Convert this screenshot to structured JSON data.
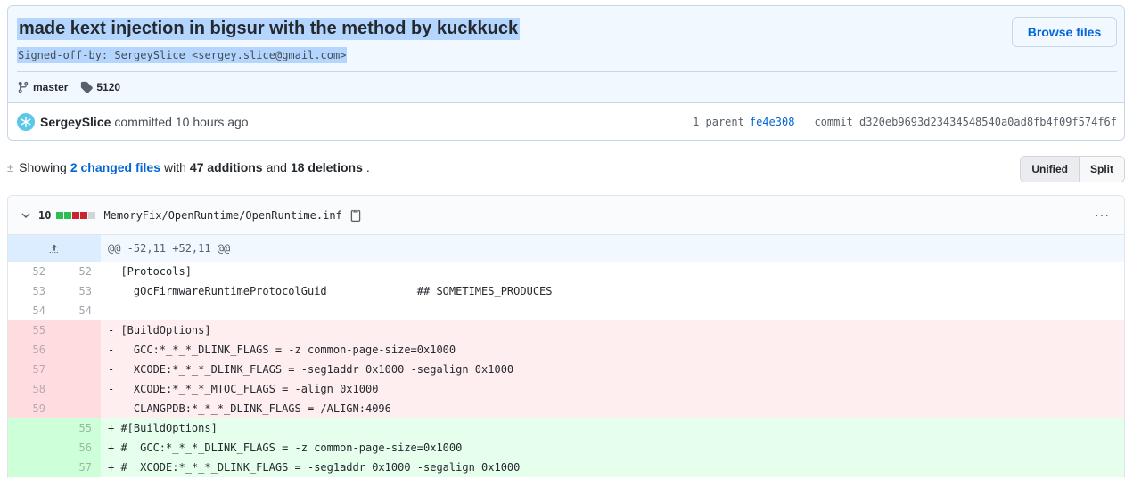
{
  "commit": {
    "title": "made kext injection in bigsur with the method by kuckkuck",
    "description": "Signed-off-by: SergeySlice <sergey.slice@gmail.com>",
    "browse_label": "Browse files",
    "branch": "master",
    "tag": "5120",
    "author": "SergeySlice",
    "committed_text": "committed 10 hours ago",
    "parent_label": "1 parent",
    "parent_sha": "fe4e308",
    "commit_label": "commit d320eb9693d23434548540a0ad8fb4f09f574f6f"
  },
  "stats": {
    "showing": "Showing",
    "changed_files": "2 changed files",
    "with": "with",
    "additions": "47 additions",
    "and": "and",
    "deletions": "18 deletions",
    "period": ".",
    "view_unified": "Unified",
    "view_split": "Split"
  },
  "file": {
    "count": "10",
    "path": "MemoryFix/OpenRuntime/OpenRuntime.inf",
    "hunk": "@@ -52,11 +52,11 @@",
    "diffstat_colors": [
      "#2cbe4e",
      "#2cbe4e",
      "#cb2431",
      "#cb2431",
      "#d1d5da"
    ]
  },
  "diff_lines": [
    {
      "type": "ctx",
      "old": "52",
      "new": "52",
      "code": "  [Protocols]"
    },
    {
      "type": "ctx",
      "old": "53",
      "new": "53",
      "code": "    gOcFirmwareRuntimeProtocolGuid              ## SOMETIMES_PRODUCES"
    },
    {
      "type": "ctx",
      "old": "54",
      "new": "54",
      "code": ""
    },
    {
      "type": "del",
      "old": "55",
      "new": "",
      "code": "- [BuildOptions]"
    },
    {
      "type": "del",
      "old": "56",
      "new": "",
      "code": "-   GCC:*_*_*_DLINK_FLAGS = -z common-page-size=0x1000"
    },
    {
      "type": "del",
      "old": "57",
      "new": "",
      "code": "-   XCODE:*_*_*_DLINK_FLAGS = -seg1addr 0x1000 -segalign 0x1000"
    },
    {
      "type": "del",
      "old": "58",
      "new": "",
      "code": "-   XCODE:*_*_*_MTOC_FLAGS = -align 0x1000"
    },
    {
      "type": "del",
      "old": "59",
      "new": "",
      "code": "-   CLANGPDB:*_*_*_DLINK_FLAGS = /ALIGN:4096"
    },
    {
      "type": "add",
      "old": "",
      "new": "55",
      "code": "+ #[BuildOptions]"
    },
    {
      "type": "add",
      "old": "",
      "new": "56",
      "code": "+ #  GCC:*_*_*_DLINK_FLAGS = -z common-page-size=0x1000"
    },
    {
      "type": "add",
      "old": "",
      "new": "57",
      "code": "+ #  XCODE:*_*_*_DLINK_FLAGS = -seg1addr 0x1000 -segalign 0x1000"
    }
  ]
}
